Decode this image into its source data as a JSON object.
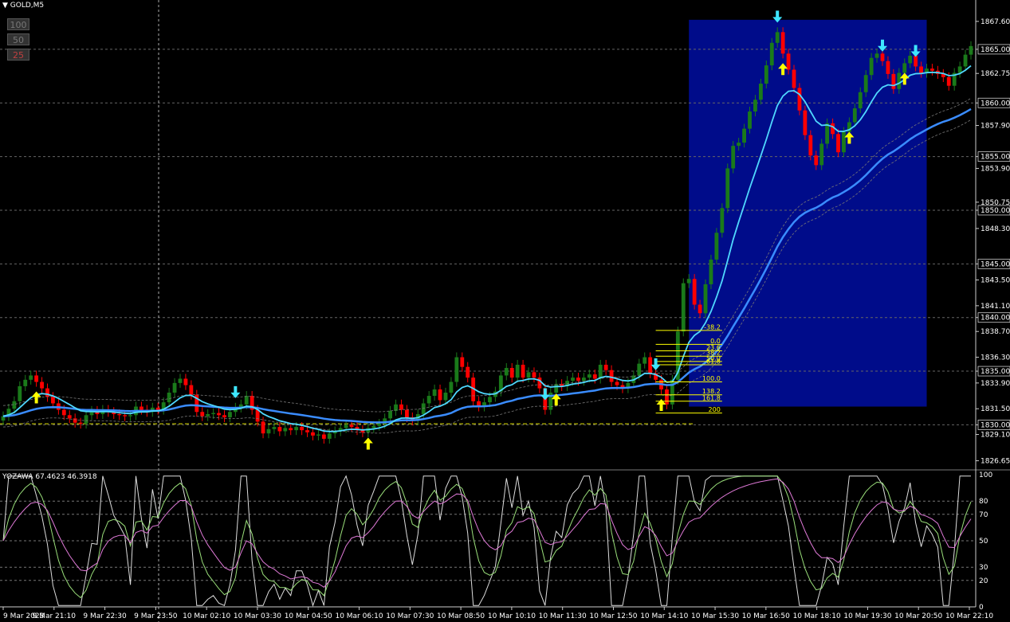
{
  "window": {
    "title": "GOLD,M5",
    "menu_icon": "triangle-down-icon"
  },
  "scale_buttons": [
    {
      "label": "100",
      "color": "#888888"
    },
    {
      "label": "50",
      "color": "#888888"
    },
    {
      "label": "25",
      "color": "#c04040"
    }
  ],
  "indicator": {
    "title": "YOZAWA 67.4623 46.3918"
  },
  "colors": {
    "bull": "#1a7a1a",
    "bear": "#ff0000",
    "ma_fast": "#4fd8ff",
    "ma_slow": "#3a8cff",
    "fib": "#ffff00",
    "box": "#000c8a",
    "arrow_up": "#ffff00",
    "arrow_down": "#3ee6ff"
  },
  "chart_data": {
    "type": "candlestick",
    "symbol": "GOLD",
    "timeframe": "M5",
    "ylim": [
      1825.8,
      1869.0
    ],
    "y_ticks": [
      1867.6,
      1865.0,
      1862.75,
      1860.0,
      1857.9,
      1855.0,
      1853.9,
      1850.75,
      1850.0,
      1848.3,
      1845.0,
      1843.5,
      1841.1,
      1840.0,
      1838.7,
      1836.3,
      1835.0,
      1833.9,
      1831.5,
      1830.0,
      1829.1,
      1826.65
    ],
    "y_tick_labels": [
      "1867.60",
      "1865.00",
      "1862.75",
      "1860.00",
      "1857.90",
      "1855.00",
      "1853.90",
      "1850.75",
      "1850.00",
      "1848.30",
      "1845.00",
      "1843.50",
      "1841.10",
      "1840.00",
      "1838.70",
      "1836.30",
      "1835.00",
      "1833.90",
      "1831.50",
      "1830.00",
      "1829.10",
      "1826.65"
    ],
    "boxed_levels": [
      1865.0,
      1860.0,
      1855.0,
      1850.0,
      1845.0,
      1840.0,
      1835.0,
      1830.0
    ],
    "x_labels": [
      "9 Mar 2023",
      "9 Mar 21:10",
      "9 Mar 22:30",
      "9 Mar 23:50",
      "10 Mar 02:10",
      "10 Mar 03:30",
      "10 Mar 04:50",
      "10 Mar 06:10",
      "10 Mar 07:30",
      "10 Mar 08:50",
      "10 Mar 10:10",
      "10 Mar 11:30",
      "10 Mar 12:50",
      "10 Mar 14:10",
      "10 Mar 15:30",
      "10 Mar 16:50",
      "10 Mar 18:10",
      "10 Mar 19:30",
      "10 Mar 20:50",
      "10 Mar 22:10"
    ],
    "closes": [
      1830.8,
      1831.5,
      1832.2,
      1833.6,
      1834.2,
      1834.6,
      1834.0,
      1833.4,
      1832.6,
      1832.0,
      1831.4,
      1830.9,
      1830.6,
      1830.2,
      1830.1,
      1830.9,
      1831.3,
      1831.0,
      1831.4,
      1831.2,
      1831.0,
      1830.9,
      1830.8,
      1830.9,
      1831.7,
      1831.4,
      1831.2,
      1831.6,
      1831.4,
      1832.1,
      1833.0,
      1833.9,
      1834.3,
      1833.7,
      1832.8,
      1831.2,
      1830.8,
      1831.0,
      1831.1,
      1830.9,
      1830.7,
      1831.2,
      1831.6,
      1831.9,
      1832.7,
      1831.4,
      1830.3,
      1829.2,
      1829.6,
      1829.8,
      1829.4,
      1829.7,
      1829.5,
      1829.8,
      1829.5,
      1829.3,
      1829.0,
      1829.1,
      1828.7,
      1829.2,
      1829.4,
      1829.7,
      1830.0,
      1829.8,
      1829.5,
      1829.3,
      1829.7,
      1829.9,
      1830.1,
      1830.6,
      1831.3,
      1831.9,
      1831.4,
      1830.7,
      1830.4,
      1831.0,
      1832.0,
      1832.7,
      1833.3,
      1832.3,
      1833.0,
      1834.0,
      1836.3,
      1835.4,
      1834.4,
      1832.2,
      1831.7,
      1832.1,
      1832.6,
      1833.1,
      1834.6,
      1835.3,
      1834.4,
      1835.6,
      1834.4,
      1834.9,
      1834.4,
      1833.4,
      1831.4,
      1833.0,
      1833.8,
      1833.6,
      1834.1,
      1834.4,
      1834.1,
      1834.4,
      1834.7,
      1834.3,
      1835.6,
      1835.1,
      1834.0,
      1833.7,
      1833.4,
      1833.9,
      1834.6,
      1835.7,
      1836.3,
      1834.8,
      1834.2,
      1833.3,
      1831.9,
      1834.2,
      1838.7,
      1843.2,
      1843.6,
      1841.2,
      1840.4,
      1843.1,
      1845.4,
      1847.9,
      1850.2,
      1853.9,
      1856.0,
      1856.3,
      1857.6,
      1859.2,
      1860.3,
      1861.8,
      1863.5,
      1865.6,
      1866.6,
      1864.6,
      1863.1,
      1861.4,
      1859.3,
      1857.0,
      1855.1,
      1854.2,
      1856.2,
      1858.1,
      1857.1,
      1855.4,
      1857.3,
      1858.2,
      1859.5,
      1861.0,
      1862.6,
      1864.2,
      1864.6,
      1863.9,
      1862.7,
      1861.3,
      1862.8,
      1863.7,
      1864.4,
      1863.4,
      1862.8,
      1863.2,
      1863.0,
      1862.7,
      1862.4,
      1861.6,
      1862.8,
      1863.4,
      1864.5,
      1865.3
    ],
    "series": [
      {
        "name": "YOZAWA",
        "role": "indicator",
        "ylim": [
          0,
          100
        ],
        "y_ticks": [
          0,
          20,
          30,
          50,
          70,
          80,
          100
        ]
      }
    ],
    "fibonacci_levels": [
      {
        "label": "-38.2",
        "price": 1838.8
      },
      {
        "label": "0.0",
        "price": 1837.5
      },
      {
        "label": "23.6",
        "price": 1836.9
      },
      {
        "label": "38.2",
        "price": 1836.4
      },
      {
        "label": "50.0",
        "price": 1835.9
      },
      {
        "label": "61.8",
        "price": 1835.6
      },
      {
        "label": "100.0",
        "price": 1834.0
      },
      {
        "label": "138.2",
        "price": 1832.8
      },
      {
        "label": "161.8",
        "price": 1832.2
      },
      {
        "label": "200",
        "price": 1831.1
      }
    ],
    "grid": true
  }
}
